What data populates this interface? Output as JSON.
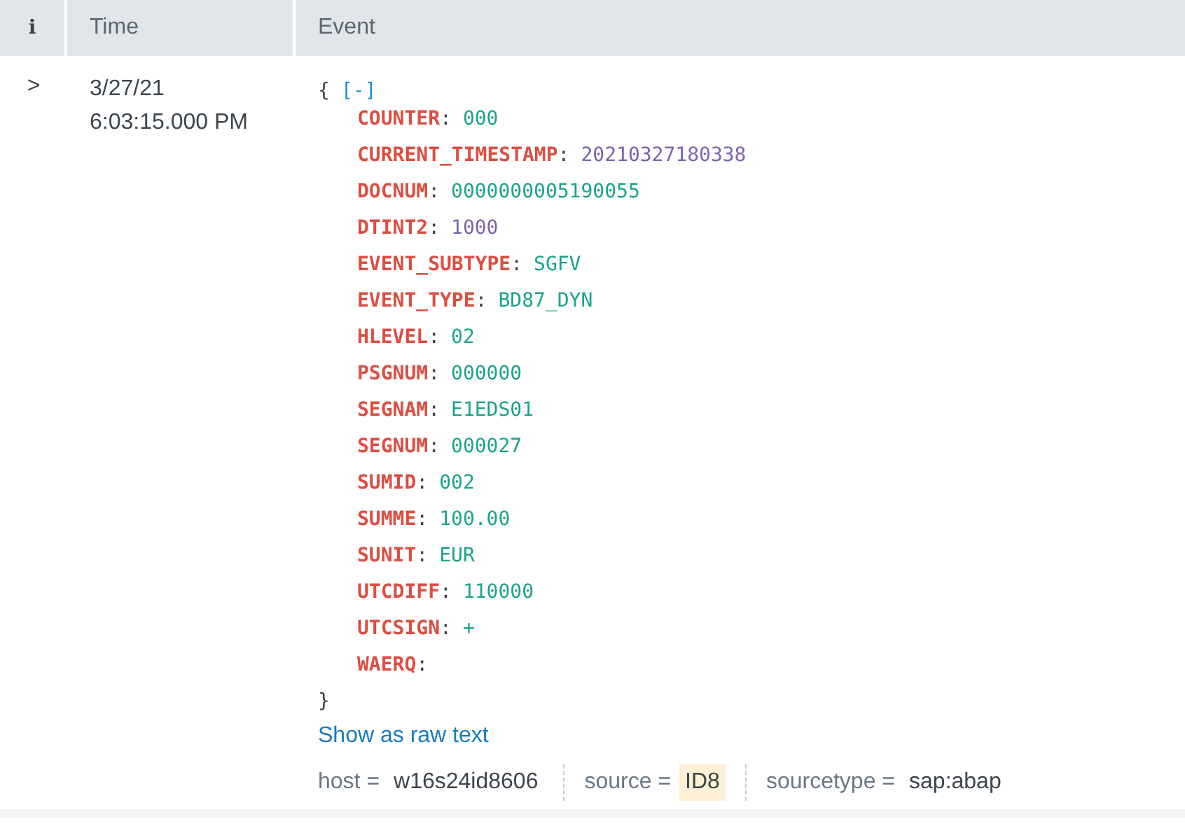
{
  "table": {
    "columns": [
      {
        "label": "i"
      },
      {
        "label": "Time"
      },
      {
        "label": "Event"
      }
    ],
    "rows": [
      {
        "expand_icon": ">",
        "time": [
          "3/27/21",
          "6:03:15.000 PM"
        ],
        "event": {
          "open_brace": "{",
          "toggle": "[-]",
          "close_brace": "}",
          "fields": [
            {
              "key": "COUNTER",
              "separator": ":",
              "value": "000",
              "kind": "string"
            },
            {
              "key": "CURRENT_TIMESTAMP",
              "separator": ":",
              "value": "20210327180338",
              "kind": "number"
            },
            {
              "key": "DOCNUM",
              "separator": ":",
              "value": "0000000005190055",
              "kind": "string"
            },
            {
              "key": "DTINT2",
              "separator": ":",
              "value": "1000",
              "kind": "number"
            },
            {
              "key": "EVENT_SUBTYPE",
              "separator": ":",
              "value": "SGFV",
              "kind": "string"
            },
            {
              "key": "EVENT_TYPE",
              "separator": ":",
              "value": "BD87_DYN",
              "kind": "string"
            },
            {
              "key": "HLEVEL",
              "separator": ":",
              "value": "02",
              "kind": "string"
            },
            {
              "key": "PSGNUM",
              "separator": ":",
              "value": "000000",
              "kind": "string"
            },
            {
              "key": "SEGNAM",
              "separator": ":",
              "value": "E1EDS01",
              "kind": "string"
            },
            {
              "key": "SEGNUM",
              "separator": ":",
              "value": "000027",
              "kind": "string"
            },
            {
              "key": "SUMID",
              "separator": ":",
              "value": "002",
              "kind": "string"
            },
            {
              "key": "SUMME",
              "separator": ":",
              "value": "100.00",
              "kind": "string"
            },
            {
              "key": "SUNIT",
              "separator": ":",
              "value": "EUR",
              "kind": "string"
            },
            {
              "key": "UTCDIFF",
              "separator": ":",
              "value": "110000",
              "kind": "string"
            },
            {
              "key": "UTCSIGN",
              "separator": ":",
              "value": "+",
              "kind": "string"
            },
            {
              "key": "WAERQ",
              "separator": ":"
            }
          ],
          "raw_link": "Show as raw text",
          "meta": [
            {
              "key": "host =",
              "value": "w16s24id8606",
              "highlighted": false
            },
            {
              "key": "source =",
              "value": "ID8",
              "highlighted": true
            },
            {
              "key": "sourcetype =",
              "value": "sap:abap",
              "highlighted": false
            }
          ]
        }
      }
    ]
  }
}
